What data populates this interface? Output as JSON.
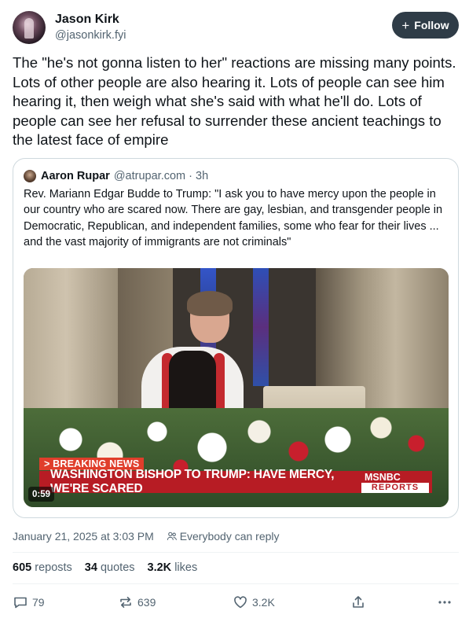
{
  "author": {
    "name": "Jason Kirk",
    "handle": "@jasonkirk.fyi",
    "follow_label": "Follow"
  },
  "post": {
    "text": "The \"he's not gonna listen to her\" reactions are missing many points. Lots of other people are also hearing it. Lots of people can see him hearing it, then weigh what she's said with what he'll do. Lots of people can see her refusal to surrender these ancient teachings to the latest face of empire"
  },
  "quote": {
    "name": "Aaron Rupar",
    "handle": "@atrupar.com",
    "time": "3h",
    "text": "Rev. Mariann Edgar Budde to Trump: \"I ask you to have mercy upon the people in our country who are scared now. There are gay, lesbian, and transgender people in Democratic, Republican, and independent families, some who fear for their lives ... and the vast majority of immigrants are not criminals\"",
    "video": {
      "breaking_label": "> BREAKING NEWS",
      "headline": "WASHINGTON BISHOP TO TRUMP: HAVE MERCY, WE'RE SCARED",
      "network": "MSNBC",
      "network_sub": "REPORTS",
      "duration": "0:59"
    }
  },
  "meta": {
    "date": "January 21, 2025 at 3:03 PM",
    "reply_setting": "Everybody can reply"
  },
  "stats": {
    "reposts_count": "605",
    "reposts_label": "reposts",
    "quotes_count": "34",
    "quotes_label": "quotes",
    "likes_count": "3.2K",
    "likes_label": "likes"
  },
  "actions": {
    "reply_count": "79",
    "repost_count": "639",
    "like_count": "3.2K"
  },
  "colors": {
    "follow_bg": "#2f3c47",
    "muted_text": "#536471",
    "border": "#cfd9de",
    "news_red": "#b71c24"
  }
}
